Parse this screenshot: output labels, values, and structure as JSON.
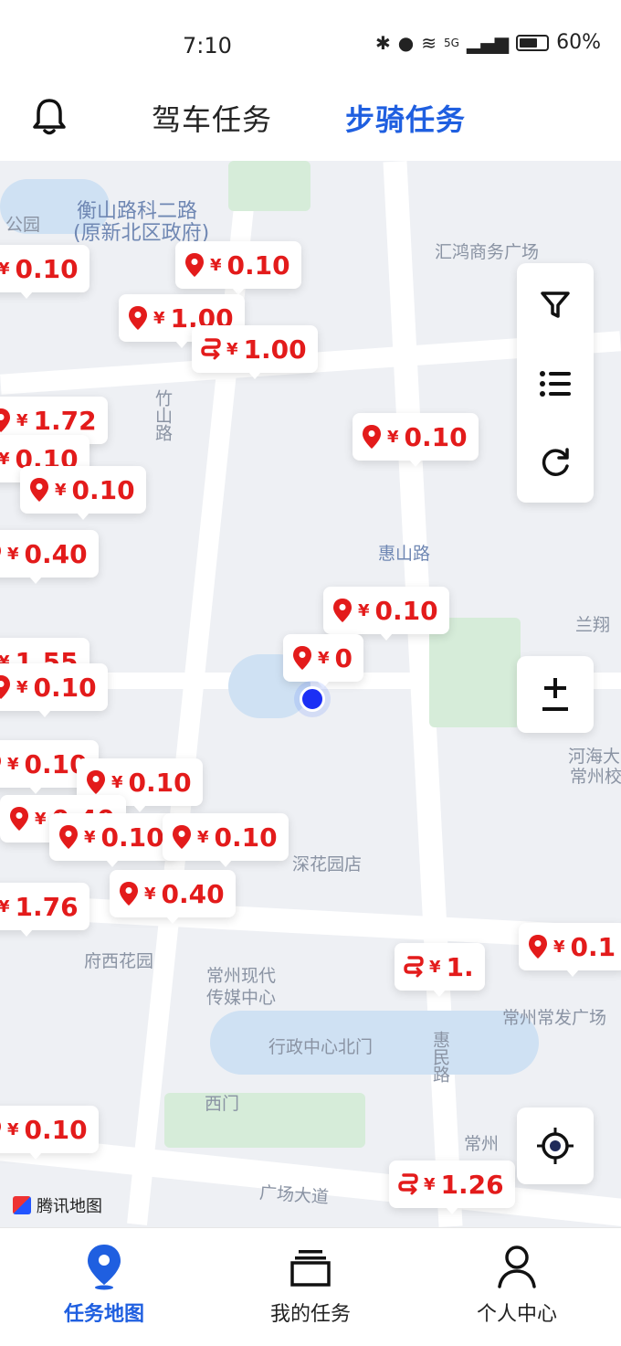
{
  "status_bar": {
    "time": "7:10",
    "network": "5G",
    "battery": "60%"
  },
  "header": {
    "tab_drive": "驾车任务",
    "tab_walk": "步骑任务"
  },
  "map_labels": [
    "衡山路科二路",
    "(原新北区政府)",
    "汇鸿商务广场",
    "竹山路",
    "惠山路",
    "兰翔",
    "河海大",
    "常州校",
    "深花园店",
    "府西花园",
    "常州现代",
    "传媒中心",
    "常州常发广场",
    "行政中心北门",
    "惠民路",
    "常州",
    "广场大道",
    "公园",
    "西门"
  ],
  "pins": [
    {
      "type": "walk",
      "amount": "0.10"
    },
    {
      "type": "walk",
      "amount": "0.10"
    },
    {
      "type": "walk",
      "amount": "1.00"
    },
    {
      "type": "ride",
      "amount": "1.00"
    },
    {
      "type": "walk",
      "amount": "1.72"
    },
    {
      "type": "walk",
      "amount": "0.10"
    },
    {
      "type": "walk",
      "amount": "0.10"
    },
    {
      "type": "walk",
      "amount": "0.40"
    },
    {
      "type": "walk",
      "amount": "0.10"
    },
    {
      "type": "walk",
      "amount": "1.55"
    },
    {
      "type": "walk",
      "amount": "0.10"
    },
    {
      "type": "walk",
      "amount": "0.10"
    },
    {
      "type": "walk",
      "amount": "0.10"
    },
    {
      "type": "walk",
      "amount": "0.40"
    },
    {
      "type": "walk",
      "amount": "0.10"
    },
    {
      "type": "walk",
      "amount": "0.10"
    },
    {
      "type": "walk",
      "amount": "0.40"
    },
    {
      "type": "walk",
      "amount": "1.76"
    },
    {
      "type": "walk",
      "amount": "0.10"
    },
    {
      "type": "walk",
      "amount": "0.10"
    },
    {
      "type": "ride",
      "amount": "1.26"
    },
    {
      "type": "ride",
      "amount": "1."
    },
    {
      "type": "walk",
      "amount": "0.1"
    },
    {
      "type": "walk",
      "amount": "0"
    }
  ],
  "map_logo": "腾讯地图",
  "icons": {
    "bell": "bell-icon",
    "filter": "filter-icon",
    "list": "list-icon",
    "refresh": "refresh-icon",
    "zoom": "zoom-icon",
    "locate": "locate-icon"
  },
  "bottom_nav": [
    {
      "label": "任务地图",
      "icon": "map-pin-icon",
      "active": true
    },
    {
      "label": "我的任务",
      "icon": "task-stack-icon",
      "active": false
    },
    {
      "label": "个人中心",
      "icon": "user-icon",
      "active": false
    }
  ],
  "colors": {
    "accent": "#1f5fe0",
    "price": "#e31b1b",
    "location_dot": "#1b2ff5"
  }
}
